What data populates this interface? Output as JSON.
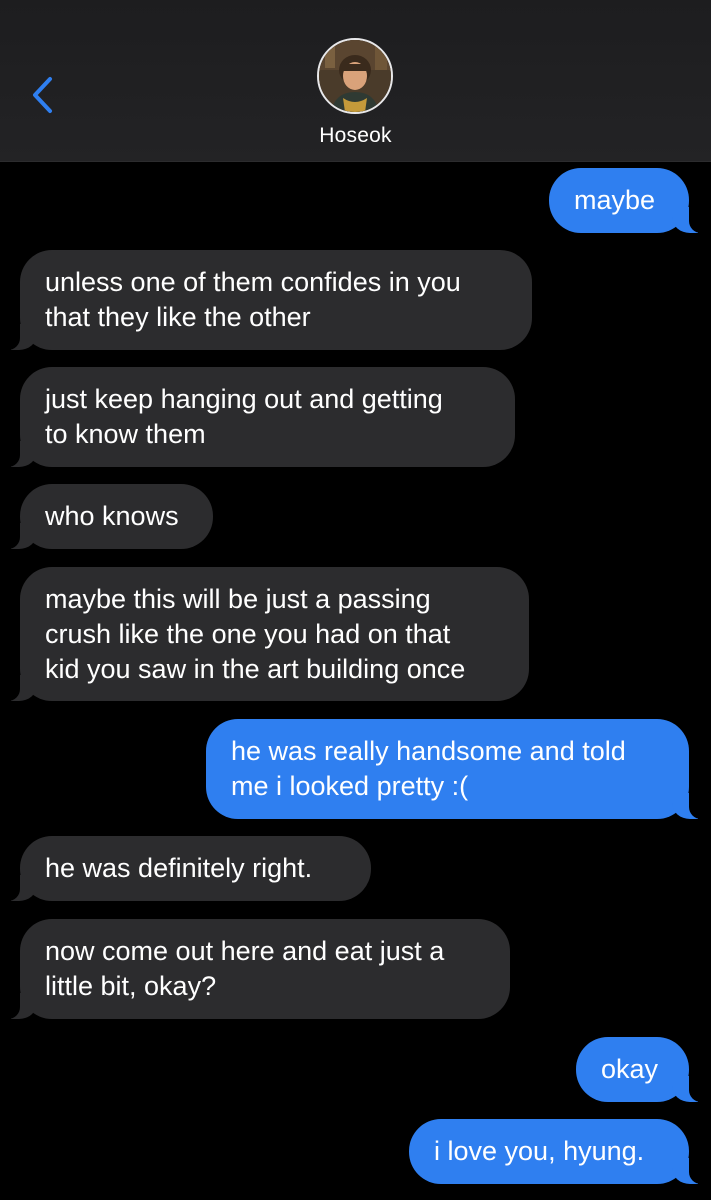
{
  "header": {
    "contact_name": "Hoseok",
    "back_icon": "chevron-left-icon",
    "accent_color": "#2f7ff0"
  },
  "messages": [
    {
      "from": "me",
      "lines": [
        "maybe"
      ]
    },
    {
      "from": "them",
      "lines": [
        "unless one of them confides in you",
        "that they like the other"
      ]
    },
    {
      "from": "them",
      "lines": [
        "just keep hanging out and getting",
        "to know them"
      ]
    },
    {
      "from": "them",
      "lines": [
        "who knows"
      ]
    },
    {
      "from": "them",
      "lines": [
        "maybe this will be just a passing",
        "crush like the one you had on that",
        "kid you saw in the art building once"
      ]
    },
    {
      "from": "me",
      "lines": [
        "he was really handsome and told",
        "me i looked pretty :("
      ]
    },
    {
      "from": "them",
      "lines": [
        "he was definitely right."
      ]
    },
    {
      "from": "them",
      "lines": [
        "now come out here and eat just a",
        "little bit, okay?"
      ]
    },
    {
      "from": "me",
      "lines": [
        "okay"
      ]
    },
    {
      "from": "me",
      "lines": [
        "i love you, hyung."
      ]
    }
  ]
}
